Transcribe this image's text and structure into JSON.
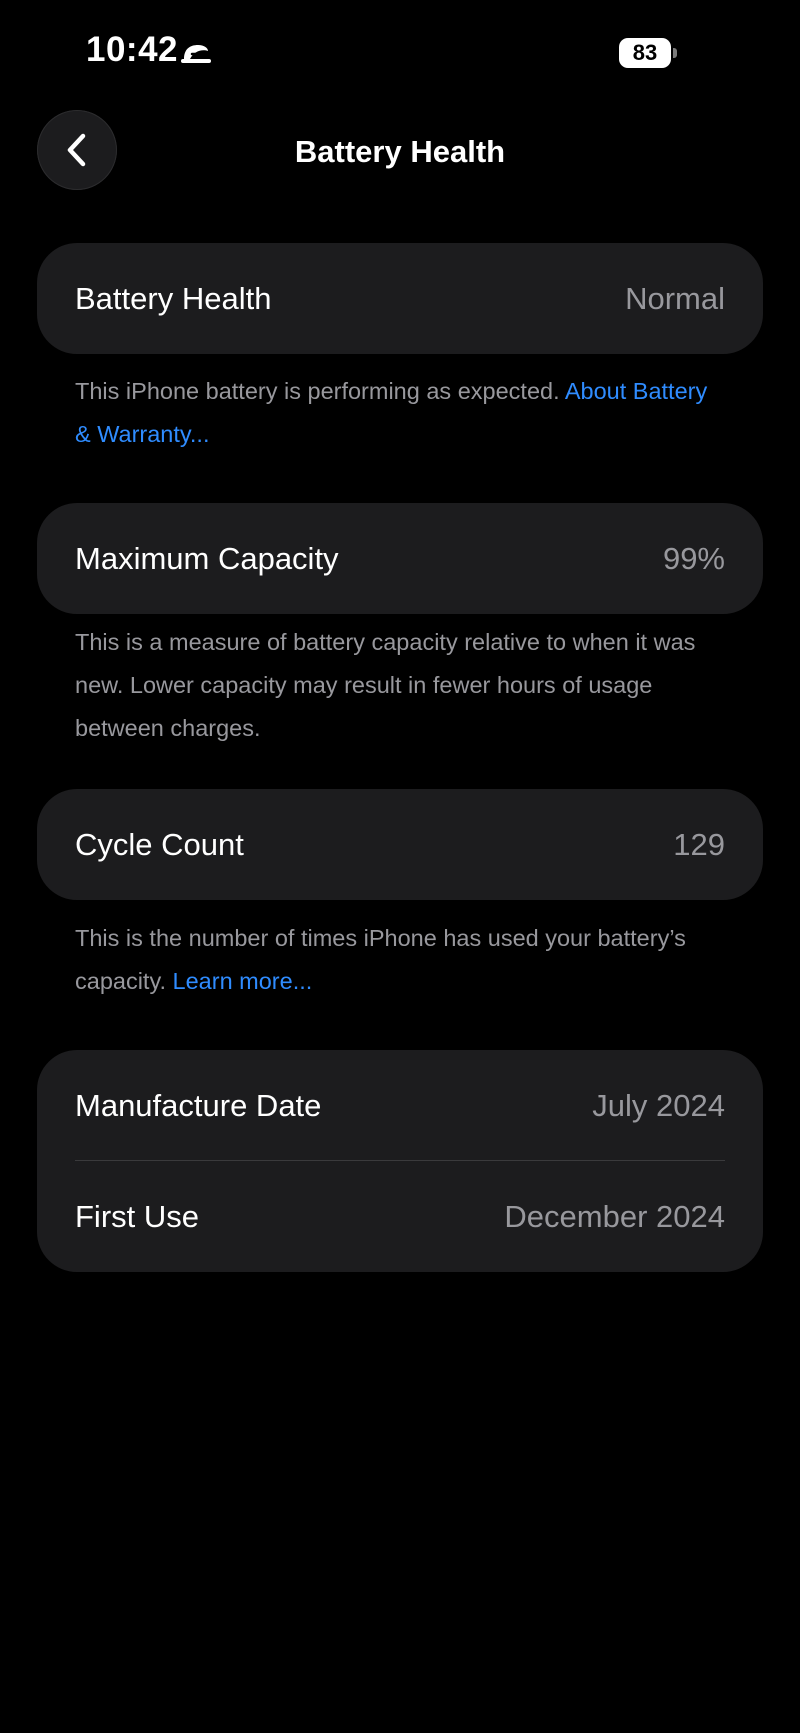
{
  "status_bar": {
    "time": "10:42",
    "battery_level": "83",
    "focus_icon": "sleep-focus-icon",
    "battery_icon": "battery-icon"
  },
  "nav": {
    "back_icon": "chevron-left-icon",
    "title": "Battery Health"
  },
  "sections": {
    "battery_health": {
      "label": "Battery Health",
      "value": "Normal",
      "note_text": "This iPhone battery is performing as expected.",
      "note_link": "About Battery & Warranty..."
    },
    "maximum_capacity": {
      "label": "Maximum Capacity",
      "value": "99%",
      "value_fraction": 0.99,
      "note_text": "This is a measure of battery capacity relative to when it was new. Lower capacity may result in fewer hours of usage between charges."
    },
    "cycle_count": {
      "label": "Cycle Count",
      "value": "129",
      "note_text": "This is the number of times iPhone has used your battery’s capacity.",
      "note_link": "Learn more..."
    },
    "dates": {
      "manufacture_label": "Manufacture Date",
      "manufacture_value": "July 2024",
      "first_use_label": "First Use",
      "first_use_value": "December 2024"
    }
  },
  "colors": {
    "background": "#000000",
    "card": "#1c1c1e",
    "secondary_text": "#98989d",
    "link": "#2f8cff"
  }
}
